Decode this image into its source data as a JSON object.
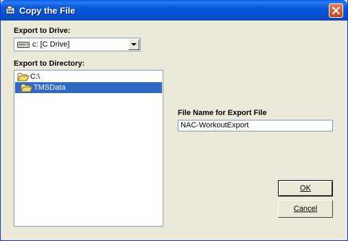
{
  "window": {
    "title": "Copy the File"
  },
  "drive": {
    "label": "Export to Drive:",
    "selected": "c: [C Drive]"
  },
  "directory": {
    "label": "Export to Directory:",
    "items": [
      {
        "name": "C:\\",
        "selected": false
      },
      {
        "name": "TMSData",
        "selected": true
      }
    ]
  },
  "filename": {
    "label": "File Name for Export File",
    "value": "NAC-WorkoutExport"
  },
  "buttons": {
    "ok": "OK",
    "cancel": "Cancel"
  }
}
